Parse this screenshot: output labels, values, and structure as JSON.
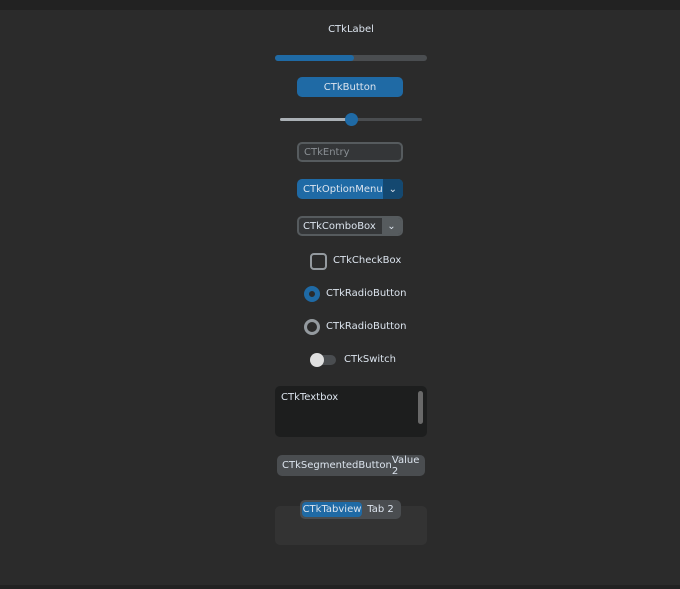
{
  "label": "CTkLabel",
  "progress": 0.52,
  "button": "CTkButton",
  "slider": 0.5,
  "entry": {
    "placeholder": "CTkEntry",
    "value": ""
  },
  "option_menu": "CTkOptionMenu",
  "combobox": "CTkComboBox",
  "checkbox": {
    "label": "CTkCheckBox",
    "checked": false
  },
  "radios": [
    {
      "label": "CTkRadioButton",
      "selected": true
    },
    {
      "label": "CTkRadioButton",
      "selected": false
    }
  ],
  "switch": {
    "label": "CTkSwitch",
    "on": false
  },
  "textbox": "CTkTextbox",
  "segmented": {
    "values": [
      "CTkSegmentedButton",
      "Value 2"
    ]
  },
  "tabview": {
    "tabs": [
      "CTkTabview",
      "Tab 2"
    ],
    "selected": 0
  },
  "colors": {
    "accent": "#1f6aa5",
    "bg": "#2b2b2b"
  }
}
